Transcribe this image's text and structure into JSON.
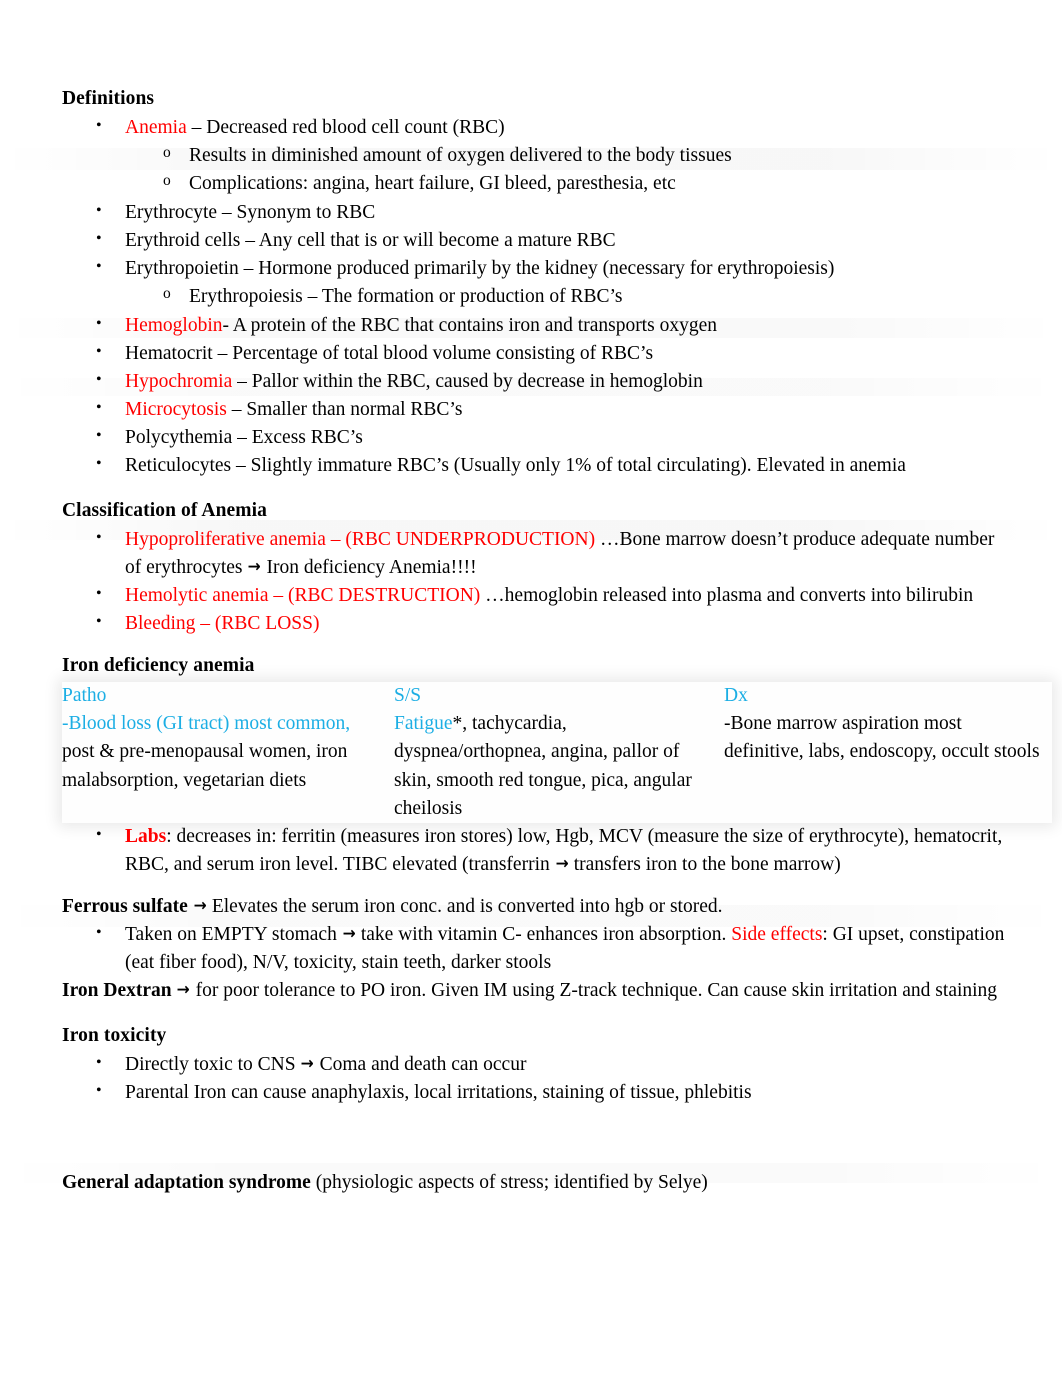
{
  "document": {
    "colors": {
      "accent_red": "#FF0000",
      "accent_cyan": "#1CAEE4",
      "text": "#000000",
      "background": "#FFFFFF"
    }
  },
  "definitions": {
    "heading": "Definitions",
    "items": [
      {
        "term": "Anemia",
        "term_color": "red",
        "rest": " – Decreased red blood cell count (RBC)",
        "sub": [
          "Results in diminished amount of oxygen delivered to the body tissues",
          "Complications: angina, heart failure, GI bleed, paresthesia, etc"
        ]
      },
      {
        "term": "",
        "rest": "Erythrocyte – Synonym to RBC",
        "sub": []
      },
      {
        "term": "",
        "rest": "Erythroid cells – Any cell that is or will become a mature RBC",
        "sub": []
      },
      {
        "term": "",
        "rest": "Erythropoietin – Hormone produced primarily by the kidney (necessary for erythropoiesis)",
        "sub": [
          "Erythropoiesis – The formation or production of RBC’s"
        ]
      },
      {
        "term": "Hemoglobin",
        "term_color": "red",
        "rest": "- A protein of the RBC that contains iron and transports oxygen",
        "sub": []
      },
      {
        "term": "",
        "rest": "Hematocrit – Percentage of total blood volume consisting of RBC’s",
        "sub": []
      },
      {
        "term": "Hypochromia",
        "term_color": "red",
        "rest": " – Pallor within the RBC, caused by decrease in hemoglobin",
        "sub": []
      },
      {
        "term": "Microcytosis",
        "term_color": "red",
        "rest": " – Smaller than normal RBC’s",
        "sub": []
      },
      {
        "term": "",
        "rest": "Polycythemia – Excess RBC’s",
        "sub": []
      },
      {
        "term": "",
        "rest": "Reticulocytes – Slightly immature RBC’s (Usually only 1% of total circulating). Elevated in anemia",
        "sub": []
      }
    ]
  },
  "classification": {
    "heading": "Classification of Anemia",
    "items": [
      {
        "red_part": "Hypoproliferative anemia – (RBC UNDERPRODUCTION)",
        "black_part_a": " …Bone marrow doesn’t produce adequate number of erythrocytes ",
        "arrow": "→",
        "black_part_b": " Iron deficiency Anemia!!!!"
      },
      {
        "red_part": "Hemolytic anemia – (RBC DESTRUCTION)",
        "black_part_a": " …hemoglobin released into plasma and converts into bilirubin",
        "arrow": "",
        "black_part_b": ""
      },
      {
        "red_part": "Bleeding – (RBC LOSS)",
        "black_part_a": "",
        "arrow": "",
        "black_part_b": ""
      }
    ]
  },
  "iron_deficiency": {
    "heading": "Iron deficiency anemia",
    "table": {
      "columns": [
        {
          "header": "Patho",
          "cyan_body": "-Blood loss (GI tract) most common,",
          "black_body": " post & pre-menopausal women, iron malabsorption, vegetarian diets"
        },
        {
          "header": "S/S",
          "cyan_body": "Fatigue",
          "black_body": "*, tachycardia, dyspnea/orthopnea, angina, pallor of skin, smooth red tongue, pica, angular cheilosis"
        },
        {
          "header": "Dx",
          "cyan_body": "",
          "black_body": "-Bone marrow aspiration most definitive, labs, endoscopy, occult stools"
        }
      ]
    },
    "labs_bullet": {
      "label": "Labs",
      "text_a": ": decreases in: ferritin (measures iron stores) low, Hgb, MCV (measure the size of erythrocyte), hematocrit, RBC, and serum iron level. TIBC elevated (transferrin ",
      "arrow": "→",
      "text_b": " transfers iron to the bone marrow)"
    }
  },
  "ferrous_sulfate": {
    "label": "Ferrous sulfate",
    "arrow": "→",
    "text": " Elevates the serum iron conc. and is converted into hgb or stored.",
    "bullet": {
      "text_a": "Taken on EMPTY stomach ",
      "arrow": "→",
      "text_b": " take with vitamin C- enhances iron absorption. ",
      "red_label": "Side effects",
      "text_c": ": GI upset, constipation (eat fiber food), N/V, toxicity, stain teeth, darker stools"
    }
  },
  "iron_dextran": {
    "label": "Iron Dextran",
    "arrow": "→",
    "text": " for poor tolerance to PO iron. Given IM using Z-track technique. Can cause skin irritation and staining"
  },
  "iron_toxicity": {
    "heading": "Iron toxicity",
    "items": [
      {
        "text_a": "Directly toxic to CNS ",
        "arrow": "→",
        "text_b": " Coma and death can occur"
      },
      {
        "text_a": "Parental Iron can cause anaphylaxis, local irritations, staining of tissue, phlebitis",
        "arrow": "",
        "text_b": ""
      }
    ]
  },
  "general_adaptation": {
    "label": "General adaptation syndrome",
    "text": " (physiologic aspects of stress; identified by Selye)"
  }
}
